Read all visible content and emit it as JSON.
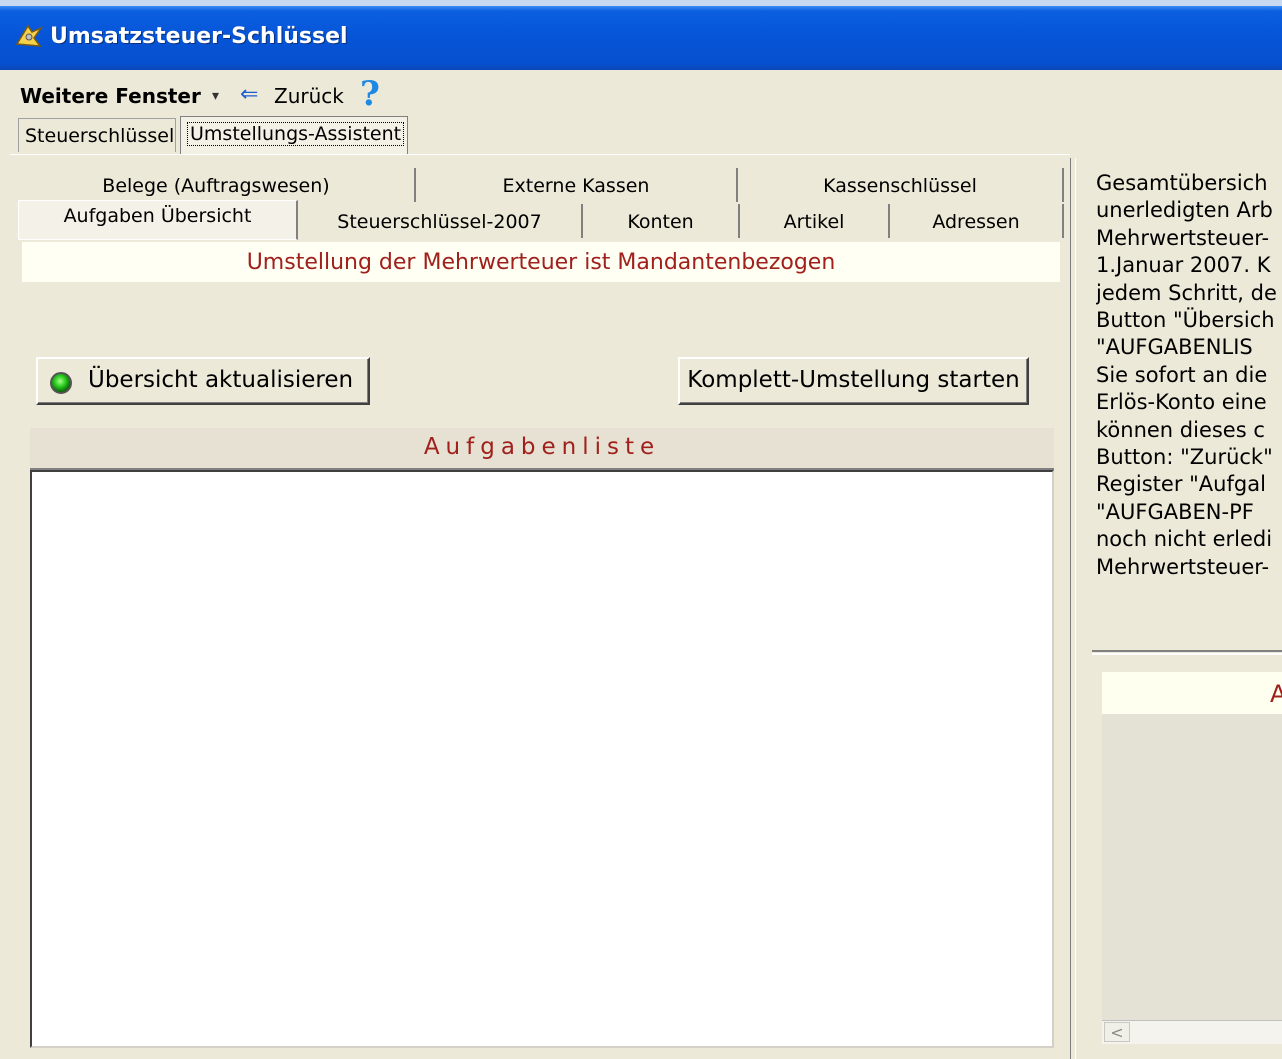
{
  "window": {
    "title": "Umsatzsteuer-Schlüssel"
  },
  "toolbar": {
    "weitere_fenster": "Weitere Fenster",
    "caret": "▾",
    "back_icon": "⇐",
    "back_label": "Zurück",
    "help": "?"
  },
  "outer_tabs": [
    {
      "label": "Steuerschlüssel"
    },
    {
      "label": "Umstellungs-Assistent"
    }
  ],
  "inner_tabs": {
    "row1": [
      {
        "label": "Belege (Auftragswesen)"
      },
      {
        "label": "Externe Kassen"
      },
      {
        "label": "Kassenschlüssel"
      }
    ],
    "row2": [
      {
        "label": "Aufgaben Übersicht"
      },
      {
        "label": "Steuerschlüssel-2007"
      },
      {
        "label": "Konten"
      },
      {
        "label": "Artikel"
      },
      {
        "label": "Adressen"
      }
    ]
  },
  "main": {
    "header": "Umstellung der Mehrwerteuer ist Mandantenbezogen",
    "btn_refresh": "Übersicht aktualisieren",
    "btn_start": "Komplett-Umstellung starten",
    "list_header": "Aufgabenliste"
  },
  "right": {
    "lines": [
      "Gesamtübersich",
      "unerledigten Arb",
      "Mehrwertsteuer-",
      "1.Januar 2007. K",
      "jedem Schritt, de",
      "Button \"Übersich",
      "\"AUFGABENLIS",
      "Sie sofort an die",
      "Erlös-Konto eine",
      "können dieses c",
      "Button: \"Zurück\"",
      "Register \"Aufgal",
      "\"AUFGABEN-PF",
      "noch nicht erledi",
      "Mehrwertsteuer-"
    ],
    "subhead": "A",
    "scroll_left": "<"
  }
}
